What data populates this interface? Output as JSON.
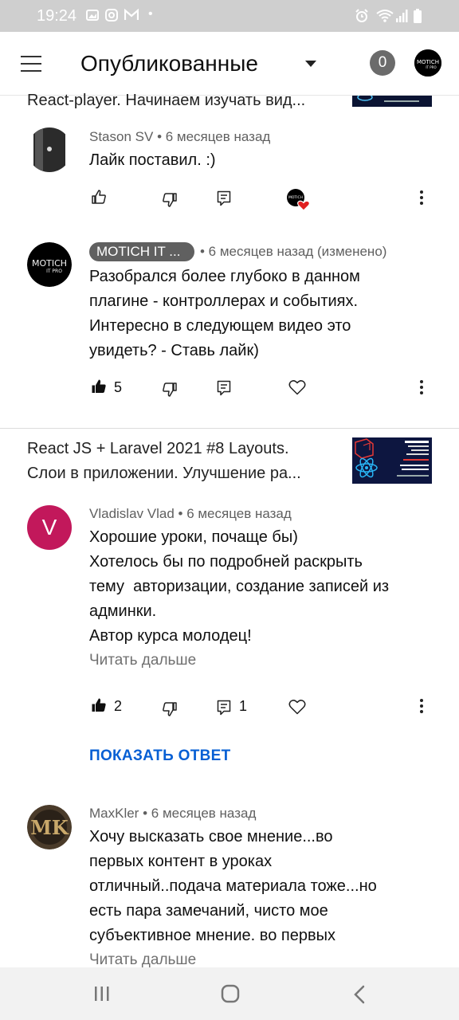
{
  "status_bar": {
    "time": "19:24"
  },
  "header": {
    "title": "Опубликованные",
    "notification_count": "0"
  },
  "videos": [
    {
      "title_lines": [
        "React-player. Начинаем изучать вид..."
      ]
    },
    {
      "title_lines": [
        "React JS + Laravel 2021 #8 Layouts.",
        "Слои в приложении. Улучшение ра..."
      ]
    }
  ],
  "comments": [
    {
      "author": "Stason SV",
      "time": "• 6 месяцев назад",
      "lines": [
        "Лайк поставил. :)"
      ],
      "likes": "",
      "replies": ""
    },
    {
      "author": "MOTICH IT ...",
      "time": "• 6 месяцев назад (изменено)",
      "lines": [
        "Разобрался более глубоко в данном",
        "плагине - контроллерах и событиях.",
        "Интересно в следующем видео это",
        "увидеть? - Ставь лайк)"
      ],
      "likes": "5",
      "replies": ""
    },
    {
      "author": "Vladislav Vlad",
      "avatar_letter": "V",
      "time": "• 6 месяцев назад",
      "lines": [
        "Хорошие уроки, почаще бы)",
        "Хотелось бы по подробней раскрыть",
        "тему  авторизации, создание записей из",
        "админки.",
        "Автор курса молодец!"
      ],
      "read_more": "Читать дальше",
      "likes": "2",
      "replies": "1",
      "show_reply": "ПОКАЗАТЬ ОТВЕТ"
    },
    {
      "author": "MaxKler",
      "time": "• 6 месяцев назад",
      "lines": [
        "Хочу высказать свое мнение...во",
        "первых контент в уроках",
        "отличный..подача материала тоже...но",
        "есть пара замечаний, чисто мое",
        "субъективное мнение. во первых"
      ],
      "read_more": "Читать дальше"
    }
  ],
  "colors": {
    "accent_blue": "#065fd4",
    "vlad_avatar": "#c2185b",
    "heart_red": "#e02020"
  }
}
